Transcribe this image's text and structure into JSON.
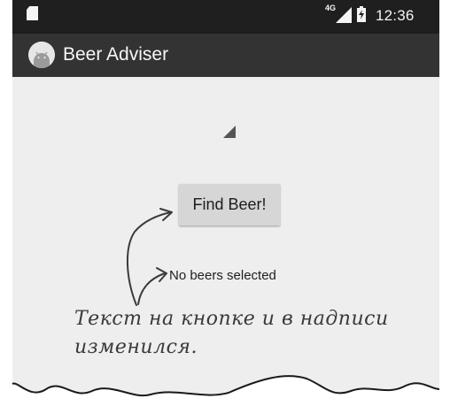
{
  "status_bar": {
    "network_label": "4G",
    "time": "12:36",
    "icons": [
      "sim-card-icon",
      "cell-signal-icon",
      "battery-icon"
    ]
  },
  "app_bar": {
    "title": "Beer Adviser",
    "logo_icon": "android-logo-icon",
    "background_color": "#333333"
  },
  "main": {
    "spinner": {
      "selected_value": "",
      "icon": "dropdown-triangle-icon"
    },
    "find_button_label": "Find Beer!",
    "result_text": "No beers selected"
  },
  "annotation": {
    "line1": "Текст на кнопке и в надписи",
    "line2": "изменился."
  },
  "colors": {
    "screen_background": "#eeeeee",
    "status_bar": "#1f1f1f",
    "button": "#d6d6d6"
  }
}
